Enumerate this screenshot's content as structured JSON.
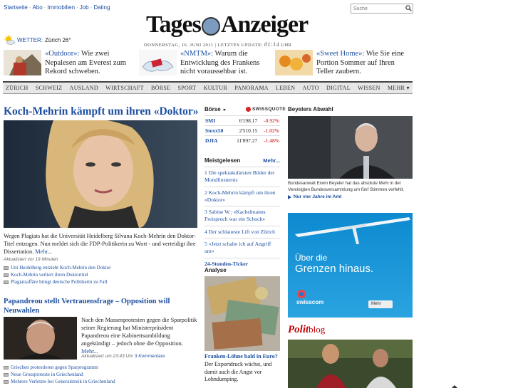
{
  "topbar": {
    "links": [
      "Startseite",
      "Abo",
      "Immobilien",
      "Job",
      "Dating"
    ],
    "search_placeholder": "Suche"
  },
  "masthead": {
    "logo_left": "Tages",
    "logo_right": "Anzeiger",
    "date": "Donnerstag, 16. Juni 2011",
    "update_label": "Letztes Update:",
    "update_time": "01:14",
    "update_unit": "Uhr"
  },
  "weather": {
    "label": "WETTER:",
    "value": "Zürich 26°"
  },
  "teasers": [
    {
      "kicker": "«Outdoor»:",
      "text": " Wie zwei Nepalesen am Everest zum Rekord schweben."
    },
    {
      "kicker": "«NMTM»:",
      "text": " Warum die Entwicklung des Frankens nicht voraussehbar ist."
    },
    {
      "kicker": "«Sweet Home»:",
      "text": " Wie Sie eine Portion Sommer auf Ihren Teller zaubern."
    }
  ],
  "nav": {
    "items": [
      "ZÜRICH",
      "SCHWEIZ",
      "AUSLAND",
      "WIRTSCHAFT",
      "BÖRSE",
      "SPORT",
      "KULTUR",
      "PANORAMA",
      "LEBEN",
      "AUTO",
      "DIGITAL",
      "WISSEN",
      "MEHR"
    ]
  },
  "lead": {
    "title": "Koch-Mehrin kämpft um ihren «Doktor»",
    "text": "Wegen Plagiats hat die Universität Heidelberg Silvana Koch-Mehrin den Doktor-Titel entzogen. Nun meldet sich die FDP-Politikerin zu Wort - und verteidigt ihre Dissertation.",
    "more": "Mehr...",
    "updated": "Aktualisiert vor 19 Minuten",
    "related": [
      "Uni Heidelberg entzieht Koch-Mehrin den Doktor",
      "Koch-Mehrin verliert ihren Doktortitel",
      "Plagiatsaffäre bringt deutsche Politikerin zu Fall"
    ]
  },
  "second": {
    "title": "Papandreou stellt Vertrauensfrage – Opposition will Neuwahlen",
    "text": "Nach den Massenprotesten gegen die Sparpolitik seiner Regierung hat Ministerpräsident Papandreou eine Kabinettsumbildung angekündigt – jedoch ohne die Opposition.",
    "more": "Mehr...",
    "updated": "Aktualisiert um 23:43 Uhr",
    "comments": "3 Kommentare",
    "related": [
      "Griechen protestieren gegen Sparprogramm",
      "Neue Grossproteste in Griechenland",
      "Mehrere Verletzte bei Generalstreik in Griechenland"
    ]
  },
  "boerse": {
    "title": "Börse",
    "sponsor": "SWISSQUOTE",
    "rows": [
      {
        "name": "SMI",
        "value": "6'198.17",
        "change": "-0.92%"
      },
      {
        "name": "Stoxx50",
        "value": "2'510.15",
        "change": "-1.02%"
      },
      {
        "name": "DJIA",
        "value": "11'897.27",
        "change": "-1.48%"
      }
    ]
  },
  "meistgelesen": {
    "title": "Meistgelesen",
    "more": "Mehr...",
    "items": [
      "1 Die spektakulärsten Bilder der Mondfinsternis",
      "2 Koch-Mehrin kämpft um ihren «Doktor»",
      "3 Sabine W.: «Kachelmanns Freispruch war ein Schock»",
      "4 Der schlaueste Lift von Zürich",
      "5 «Jetzt schalte ich auf Angriff um»"
    ],
    "ticker": "24-Stunden-Ticker"
  },
  "analyse": {
    "title": "Analyse",
    "headline": "Franken-Löhne bald in Euro?",
    "text": "Der Exportdruck wächst, und damit auch die Angst vor Lohndumping."
  },
  "beyeler": {
    "title": "Beyelers Abwahl",
    "caption": "Bundesanwalt Erwin Beyeler hat das absolute Mehr in der Vereinigten Bundesversammlung um fünf Stimmen verfehlt.",
    "link": "Nur vier Jahre im Amt"
  },
  "ad": {
    "line1": "Über die",
    "line2": "Grenzen hinaus.",
    "brand": "swisscom",
    "button": "Mehr"
  },
  "politblog": {
    "part1": "Polit",
    "part2": "blog"
  },
  "colors": {
    "link": "#1d4fa0",
    "negative": "#c00000",
    "ad_blue": "#0d8ad0",
    "politblog_red": "#c40000"
  }
}
